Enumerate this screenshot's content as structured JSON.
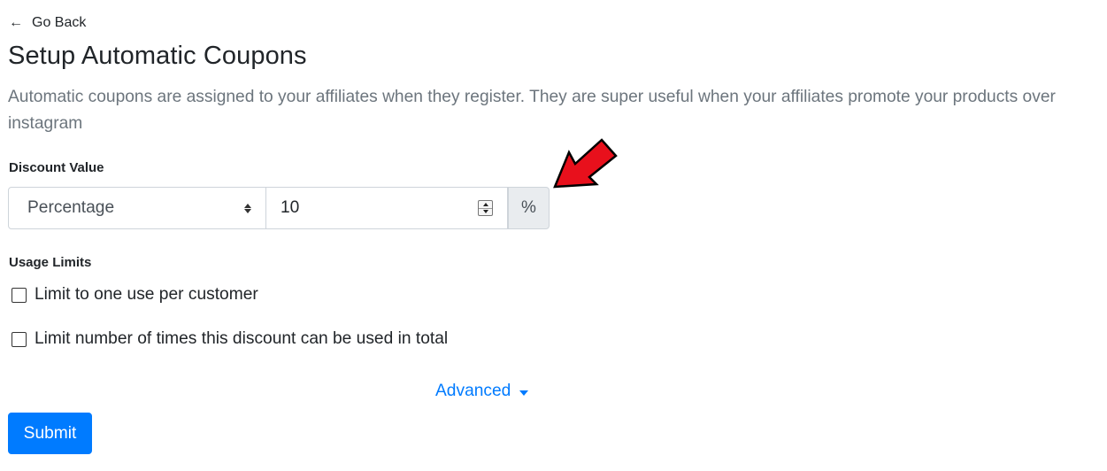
{
  "header": {
    "back_label": "Go Back",
    "back_icon": "arrow-left-icon",
    "title": "Setup Automatic Coupons",
    "description": "Automatic coupons are assigned to your affiliates when they register. They are super useful when your affiliates promote your products over instagram"
  },
  "discount": {
    "label": "Discount Value",
    "type_selected": "Percentage",
    "value": "10",
    "unit": "%"
  },
  "usage": {
    "label": "Usage Limits",
    "options": [
      {
        "label": "Limit to one use per customer",
        "checked": false
      },
      {
        "label": "Limit number of times this discount can be used in total",
        "checked": false
      }
    ]
  },
  "advanced": {
    "label": "Advanced",
    "icon": "caret-down-icon"
  },
  "submit_label": "Submit",
  "colors": {
    "primary": "#007bff",
    "muted_text": "#6c757d",
    "annotation_arrow": "#e8101c"
  }
}
